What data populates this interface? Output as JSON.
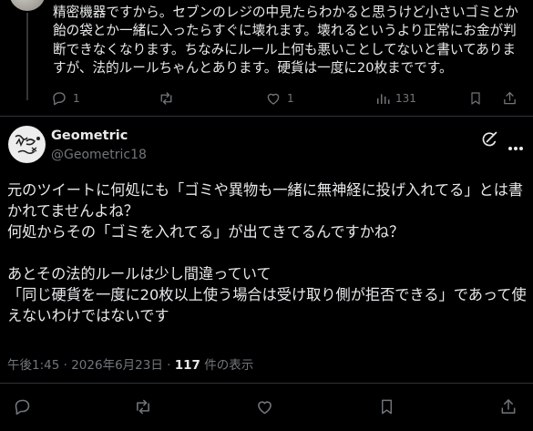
{
  "previous_reply": {
    "text": "精密機器ですから。セブンのレジの中見たらわかると思うけど小さいゴミとか飴の袋とか一緒に入ったらすぐに壊れます。壊れるというより正常にお金が判断できなくなります。ちなみにルール上何も悪いことしてないと書いてありますが、法的ルールちゃんとあります。硬貨は一度に20枚までです。",
    "reply_count": "1",
    "repost_count": "",
    "like_count": "1",
    "view_count": "131"
  },
  "tweet": {
    "author_name": "Geometric",
    "author_handle": "@Geometric18",
    "text": "元のツイートに何処にも「ゴミや異物も一緒に無神経に投げ入れてる」とは書かれてませんよね？\n何処からその「ゴミを入れてる」が出てきてるんですかね？\n\nあとその法的ルールは少し間違っていて\n「同じ硬貨を一度に20枚以上使う場合は受け取り側が拒否できる」であって使えないわけではないです",
    "time": "午後1:45",
    "separator": "·",
    "date": "2026年6月23日",
    "separator2": "·",
    "views_number": "117",
    "views_label": " 件の表示"
  },
  "icons": {
    "reply": "reply-icon",
    "repost": "repost-icon",
    "like": "heart-icon",
    "views": "views-icon",
    "bookmark": "bookmark-icon",
    "share": "share-icon",
    "grok": "grok-icon",
    "more": "more-icon"
  },
  "colors": {
    "background": "#000000",
    "text": "#e7e9ea",
    "muted": "#71767b",
    "divider": "#2f3336"
  }
}
